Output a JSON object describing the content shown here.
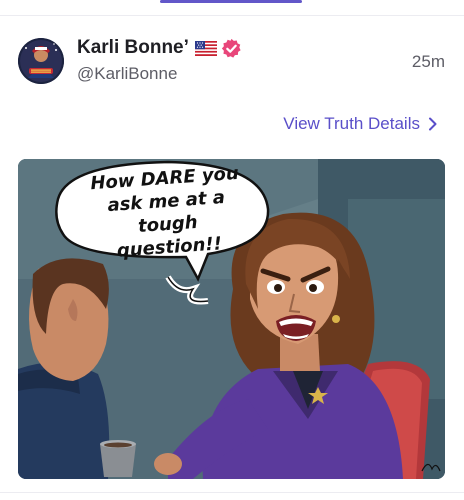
{
  "post": {
    "display_name": "Karli Bonne’",
    "handle": "@KarliBonne",
    "timestamp": "25m",
    "view_details_label": "View Truth Details",
    "flag_icon": "us-flag-icon",
    "verified_icon": "verified-badge-icon",
    "verified_color": "#e8467a"
  },
  "media": {
    "speech_bubble_text": "How DARE you\nask me at a\ntough question!!"
  },
  "colors": {
    "accent": "#5a4fc9",
    "tab_indicator": "#6257c9",
    "text_primary": "#1f1f24",
    "text_secondary": "#5d5d66"
  }
}
